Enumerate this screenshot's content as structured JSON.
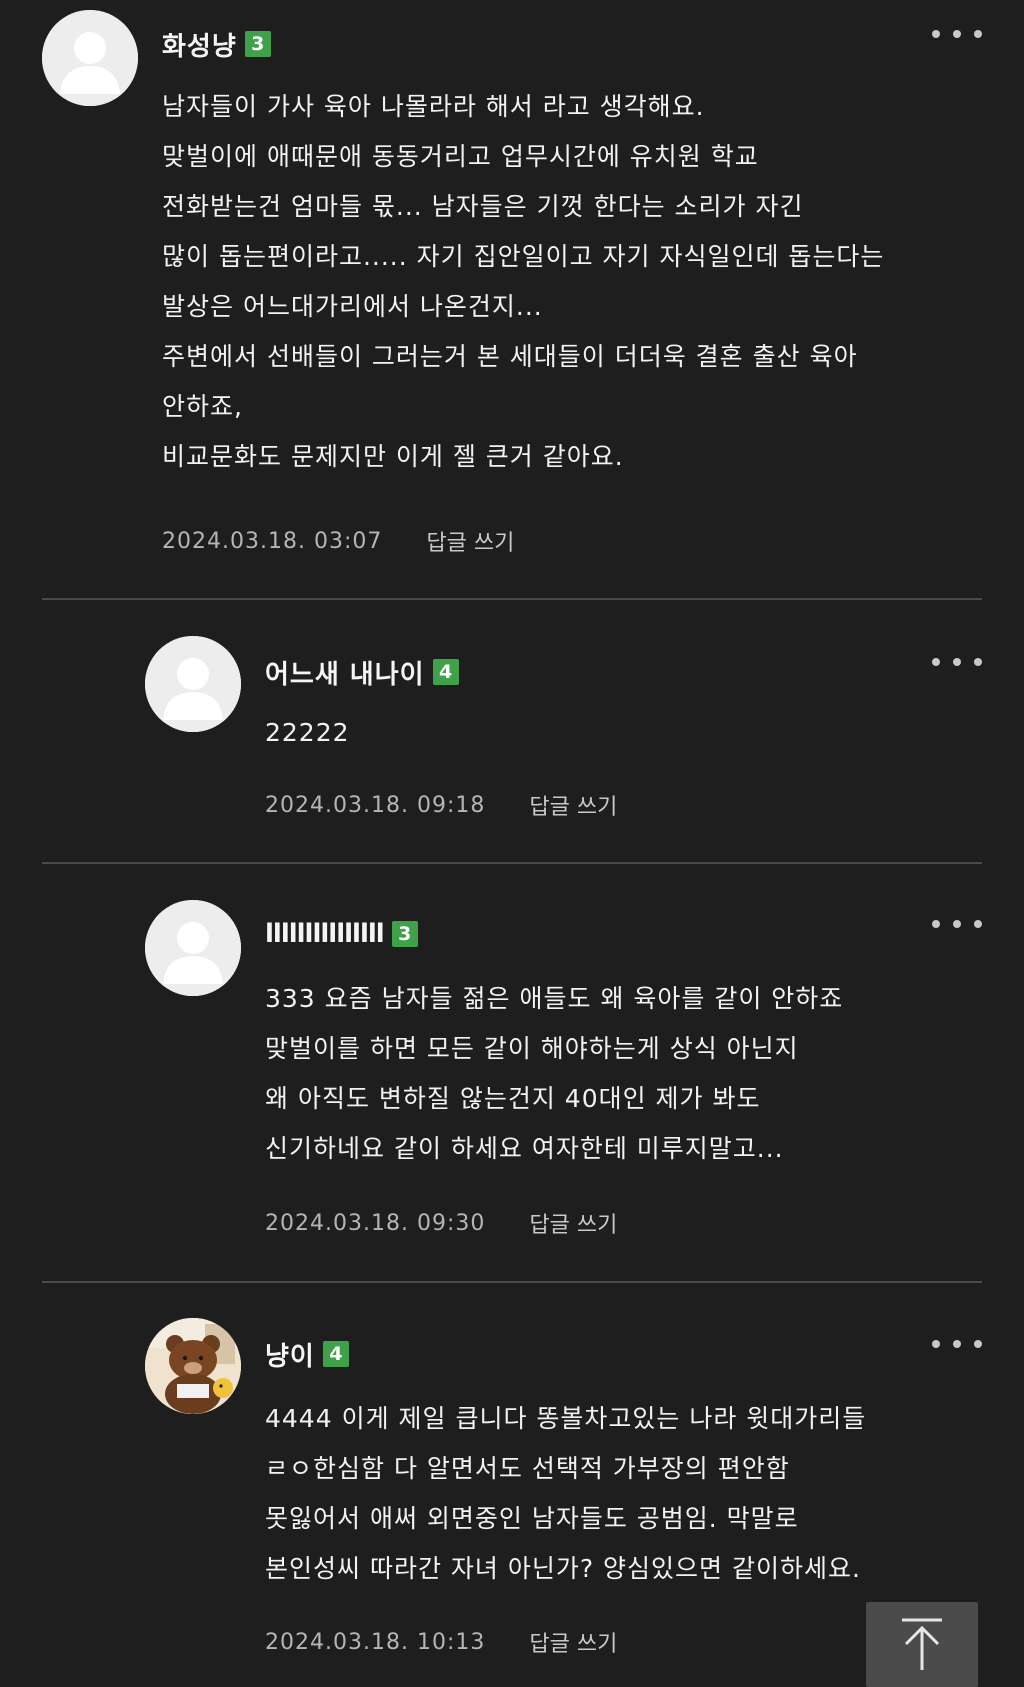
{
  "comments": [
    {
      "author": "화성냥",
      "level": "3",
      "avatar": "default-profile",
      "text": "남자들이 가사 육아 나몰라라 해서 라고 생각해요.\n맞벌이에 애때문애 동동거리고 업무시간에 유치원 학교\n전화받는건 엄마들 몫... 남자들은 기껏 한다는 소리가 자긴\n많이 돕는편이라고..... 자기 집안일이고 자기 자식일인데 돕는다는\n발상은 어느대가리에서 나온건지...\n주변에서 선배들이 그러는거 본 세대들이 더더욱 결혼 출산 육아\n안하죠,\n비교문화도 문제지만 이게 젤 큰거 같아요.",
      "date": "2024.03.18. 03:07",
      "reply_label": "답글 쓰기"
    },
    {
      "author": "어느새 내나이",
      "level": "4",
      "avatar": "default-profile",
      "text": "22222",
      "date": "2024.03.18. 09:18",
      "reply_label": "답글 쓰기"
    },
    {
      "author": "lllllllllllllll",
      "level": "3",
      "avatar": "default-profile",
      "text": "333 요즘 남자들 젊은 애들도 왜 육아를 같이 안하죠\n맞벌이를 하면 모든 같이 해야하는게 상식 아닌지\n왜 아직도 변하질 않는건지 40대인 제가 봐도\n신기하네요 같이 하세요 여자한테 미루지말고...",
      "date": "2024.03.18. 09:30",
      "reply_label": "답글 쓰기"
    },
    {
      "author": "냥이",
      "level": "4",
      "avatar": "brown-bear-photo",
      "text": "4444 이게 제일 큽니다 똥볼차고있는 나라 윗대가리들\nㄹㅇ한심함 다 알면서도 선택적 가부장의 편안함\n못잃어서 애써 외면중인 남자들도 공범임. 막말로\n본인성씨 따라간 자녀 아닌가? 양심있으면 같이하세요.",
      "date": "2024.03.18. 10:13",
      "reply_label": "답글 쓰기"
    }
  ],
  "more_icon": "more-horizontal-icon",
  "scroll_top_icon": "arrow-up-to-top-icon",
  "colors": {
    "background": "#1e1e1e",
    "level_badge": "#3fa24a",
    "divider": "#4a4a4a",
    "meta_text": "#b5b5b5"
  }
}
